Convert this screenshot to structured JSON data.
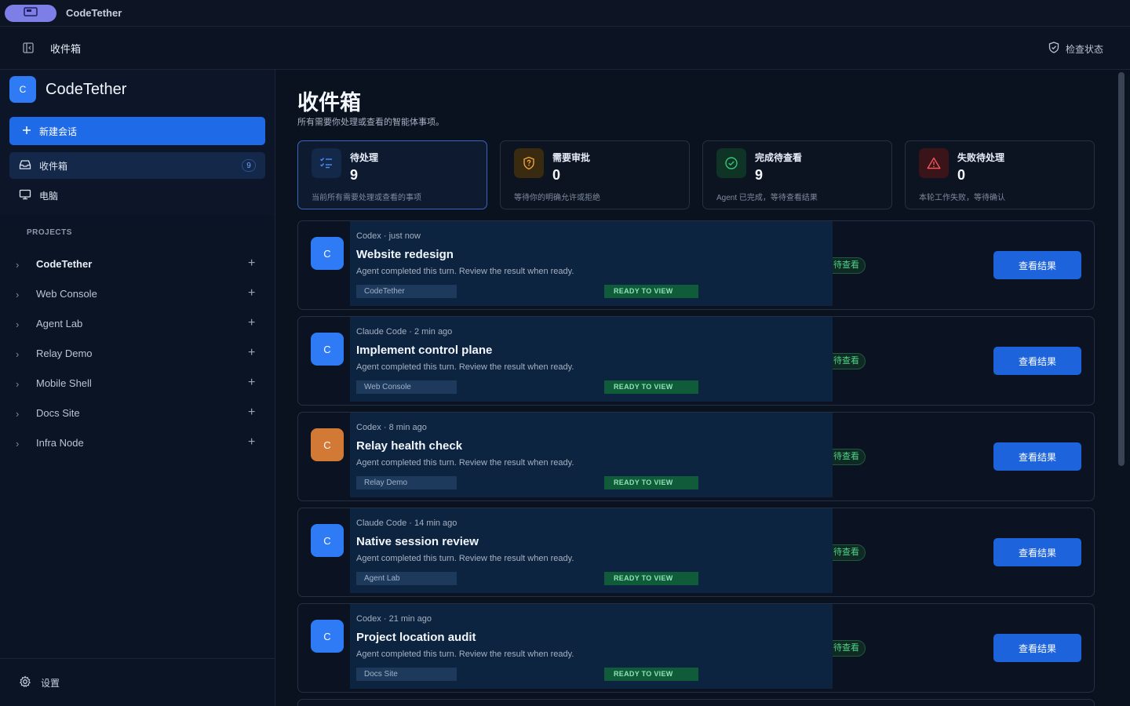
{
  "titlebar": {
    "app_name": "CodeTether"
  },
  "topbar": {
    "heading": "收件箱",
    "check_status_label": "检查状态"
  },
  "sidebar": {
    "brand": {
      "logo_letter": "C",
      "name": "CodeTether"
    },
    "new_session_label": "新建会话",
    "nav": [
      {
        "label": "收件箱",
        "badge": "9",
        "active": true,
        "icon": "inbox-icon"
      },
      {
        "label": "电脑",
        "active": false,
        "icon": "monitor-icon"
      }
    ],
    "projects_label": "PROJECTS",
    "projects": [
      "CodeTether",
      "Web Console",
      "Agent Lab",
      "Relay Demo",
      "Mobile Shell",
      "Docs Site",
      "Infra Node"
    ],
    "settings_label": "设置"
  },
  "main": {
    "title": "收件箱",
    "subtitle": "所有需要你处理或查看的智能体事项。",
    "stats": [
      {
        "label": "待处理",
        "value": "9",
        "desc": "当前所有需要处理或查看的事项",
        "icon": "checklist-icon",
        "color": "#3b82f6"
      },
      {
        "label": "需要审批",
        "value": "0",
        "desc": "等待你的明确允许或拒绝",
        "icon": "shield-question-icon",
        "color": "#f59e0b"
      },
      {
        "label": "完成待查看",
        "value": "9",
        "desc": "Agent 已完成，等待查看结果",
        "icon": "check-circle-icon",
        "color": "#22c55e"
      },
      {
        "label": "失败待处理",
        "value": "0",
        "desc": "本轮工作失败，等待确认",
        "icon": "warning-icon",
        "color": "#ef4444"
      }
    ],
    "cards": [
      {
        "avatar": "C",
        "avatar_color": "#2f7bf5",
        "meta": "Codex · just now",
        "title": "Website redesign",
        "desc": "Agent completed this turn. Review the result when ready.",
        "project": "CodeTether",
        "ready": "READY TO VIEW",
        "status": "待查看",
        "action": "查看结果"
      },
      {
        "avatar": "C",
        "avatar_color": "#2f7bf5",
        "meta": "Claude Code · 2 min ago",
        "title": "Implement control plane",
        "desc": "Agent completed this turn. Review the result when ready.",
        "project": "Web Console",
        "ready": "READY TO VIEW",
        "status": "待查看",
        "action": "查看结果"
      },
      {
        "avatar": "C",
        "avatar_color": "#d27a35",
        "meta": "Codex · 8 min ago",
        "title": "Relay health check",
        "desc": "Agent completed this turn. Review the result when ready.",
        "project": "Relay Demo",
        "ready": "READY TO VIEW",
        "status": "待查看",
        "action": "查看结果"
      },
      {
        "avatar": "C",
        "avatar_color": "#2f7bf5",
        "meta": "Claude Code · 14 min ago",
        "title": "Native session review",
        "desc": "Agent completed this turn. Review the result when ready.",
        "project": "Agent Lab",
        "ready": "READY TO VIEW",
        "status": "待查看",
        "action": "查看结果"
      },
      {
        "avatar": "C",
        "avatar_color": "#2f7bf5",
        "meta": "Codex · 21 min ago",
        "title": "Project location audit",
        "desc": "Agent completed this turn. Review the result when ready.",
        "project": "Docs Site",
        "ready": "READY TO VIEW",
        "status": "待查看",
        "action": "查看结果"
      }
    ]
  }
}
